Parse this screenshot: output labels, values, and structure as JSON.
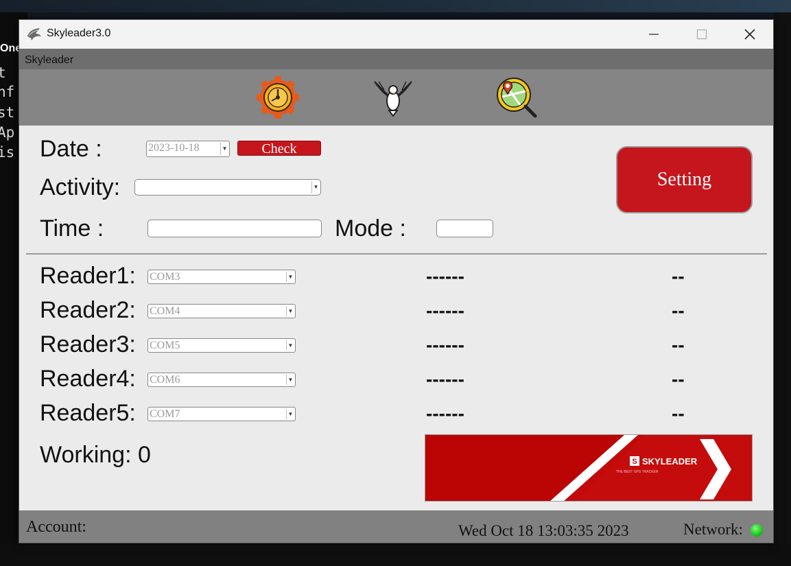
{
  "window": {
    "title": "Skyleader3.0"
  },
  "menu": {
    "label": "Skyleader"
  },
  "toolbar": {
    "icons": [
      "gear-timer-icon",
      "pigeon-icon",
      "map-search-icon"
    ]
  },
  "form": {
    "date_label": "Date :",
    "date_value": "2023-10-18",
    "check_label": "Check",
    "activity_label": "Activity:",
    "activity_value": "",
    "time_label": "Time :",
    "time_value": "",
    "mode_label": "Mode :",
    "mode_value": "",
    "setting_label": "Setting"
  },
  "readers": [
    {
      "label": "Reader1:",
      "port": "COM3",
      "status": "------",
      "code": "--"
    },
    {
      "label": "Reader2:",
      "port": "COM4",
      "status": "------",
      "code": "--"
    },
    {
      "label": "Reader3:",
      "port": "COM5",
      "status": "------",
      "code": "--"
    },
    {
      "label": "Reader4:",
      "port": "COM6",
      "status": "------",
      "code": "--"
    },
    {
      "label": "Reader5:",
      "port": "COM7",
      "status": "------",
      "code": "--"
    }
  ],
  "working": {
    "text": "Working: 0"
  },
  "banner": {
    "brand": "SKYLEADER",
    "tagline": "THE BEST GPS TRACKER"
  },
  "status": {
    "account_label": "Account:",
    "datetime": "Wed Oct 18 13:03:35 2023",
    "network_label": "Network:",
    "network_color": "#1ec81e"
  },
  "background": {
    "terminal_lines": [
      "t",
      "nf",
      "st",
      "Ap",
      "is"
    ],
    "terminal_tab": "One"
  },
  "colors": {
    "accent_red": "#c5161d",
    "toolbar_gray": "#858585",
    "status_gray": "#818181"
  }
}
